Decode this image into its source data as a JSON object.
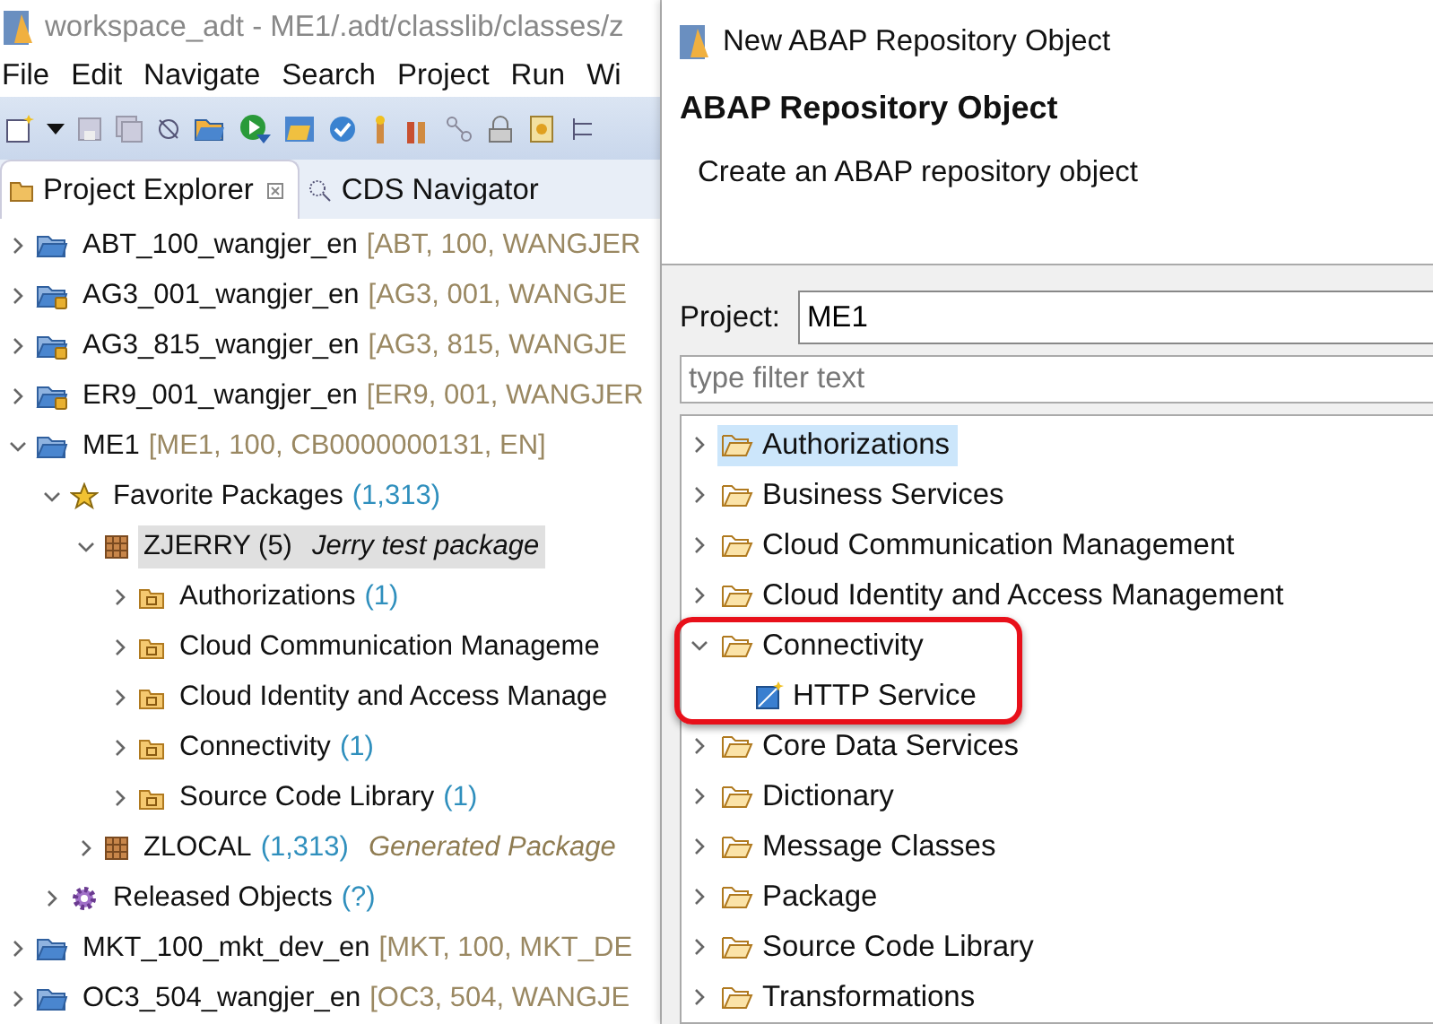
{
  "workspace": {
    "title": "workspace_adt - ME1/.adt/classlib/classes/z",
    "menu": [
      "File",
      "Edit",
      "Navigate",
      "Search",
      "Project",
      "Run",
      "Wi"
    ],
    "tabs": [
      {
        "label": "Project Explorer",
        "selected": true
      },
      {
        "label": "CDS Navigator",
        "selected": false
      }
    ],
    "tree": [
      {
        "kind": "project",
        "label": "ABT_100_wangjer_en",
        "detail": "[ABT, 100, WANGJER",
        "expanded": false,
        "selected": false
      },
      {
        "kind": "locked",
        "label": "AG3_001_wangjer_en",
        "detail": "[AG3, 001, WANGJE",
        "expanded": false,
        "selected": false
      },
      {
        "kind": "locked",
        "label": "AG3_815_wangjer_en",
        "detail": "[AG3, 815, WANGJE",
        "expanded": false,
        "selected": false
      },
      {
        "kind": "locked",
        "label": "ER9_001_wangjer_en",
        "detail": "[ER9, 001, WANGJER",
        "expanded": false,
        "selected": false
      },
      {
        "kind": "project",
        "label": "ME1",
        "detail": "[ME1, 100, CB0000000131, EN]",
        "expanded": true,
        "selected": false,
        "children": [
          {
            "kind": "favorites",
            "label": "Favorite Packages",
            "count": "(1,313)",
            "expanded": true,
            "selected": false,
            "children": [
              {
                "kind": "package",
                "label": "ZJERRY (5)",
                "description": "Jerry test package",
                "expanded": true,
                "selected": true,
                "children": [
                  {
                    "kind": "group",
                    "label": "Authorizations",
                    "count": "(1)",
                    "expanded": false,
                    "selected": false
                  },
                  {
                    "kind": "group",
                    "label": "Cloud Communication Manageme",
                    "expanded": false,
                    "selected": false
                  },
                  {
                    "kind": "group",
                    "label": "Cloud Identity and Access Manage",
                    "expanded": false,
                    "selected": false
                  },
                  {
                    "kind": "group",
                    "label": "Connectivity",
                    "count": "(1)",
                    "expanded": false,
                    "selected": false
                  },
                  {
                    "kind": "group",
                    "label": "Source Code Library",
                    "count": "(1)",
                    "expanded": false,
                    "selected": false
                  }
                ]
              },
              {
                "kind": "package",
                "label": "ZLOCAL",
                "count": "(1,313)",
                "description": "Generated Package",
                "expanded": false,
                "selected": false
              }
            ]
          },
          {
            "kind": "released",
            "label": "Released Objects",
            "count": "(?)",
            "expanded": false,
            "selected": false
          }
        ]
      },
      {
        "kind": "project",
        "label": "MKT_100_mkt_dev_en",
        "detail": "[MKT, 100, MKT_DE",
        "expanded": false,
        "selected": false
      },
      {
        "kind": "project",
        "label": "OC3_504_wangjer_en",
        "detail": "[OC3, 504, WANGJE",
        "expanded": false,
        "selected": false
      }
    ]
  },
  "dialog": {
    "title": "New ABAP Repository Object",
    "heading": "ABAP Repository Object",
    "description": "Create an ABAP repository object",
    "project_label": "Project:",
    "project_value": "ME1",
    "filter_placeholder": "type filter text",
    "tree": [
      {
        "kind": "folder",
        "label": "Authorizations",
        "expanded": false,
        "selected": true,
        "highlighted": false
      },
      {
        "kind": "folder",
        "label": "Business Services",
        "expanded": false,
        "selected": false,
        "highlighted": false
      },
      {
        "kind": "folder",
        "label": "Cloud Communication Management",
        "expanded": false,
        "selected": false,
        "highlighted": false
      },
      {
        "kind": "folder",
        "label": "Cloud Identity and Access Management",
        "expanded": false,
        "selected": false,
        "highlighted": false
      },
      {
        "kind": "folder",
        "label": "Connectivity",
        "expanded": true,
        "selected": false,
        "highlighted": true,
        "children": [
          {
            "kind": "service",
            "label": "HTTP Service",
            "selected": false,
            "highlighted": false
          }
        ]
      },
      {
        "kind": "folder",
        "label": "Core Data Services",
        "expanded": false,
        "selected": false,
        "highlighted": false
      },
      {
        "kind": "folder",
        "label": "Dictionary",
        "expanded": false,
        "selected": false,
        "highlighted": false
      },
      {
        "kind": "folder",
        "label": "Message Classes",
        "expanded": false,
        "selected": false,
        "highlighted": false
      },
      {
        "kind": "folder",
        "label": "Package",
        "expanded": false,
        "selected": false,
        "highlighted": false
      },
      {
        "kind": "folder",
        "label": "Source Code Library",
        "expanded": false,
        "selected": false,
        "highlighted": false
      },
      {
        "kind": "folder",
        "label": "Transformations",
        "expanded": false,
        "selected": false,
        "highlighted": false
      }
    ]
  }
}
